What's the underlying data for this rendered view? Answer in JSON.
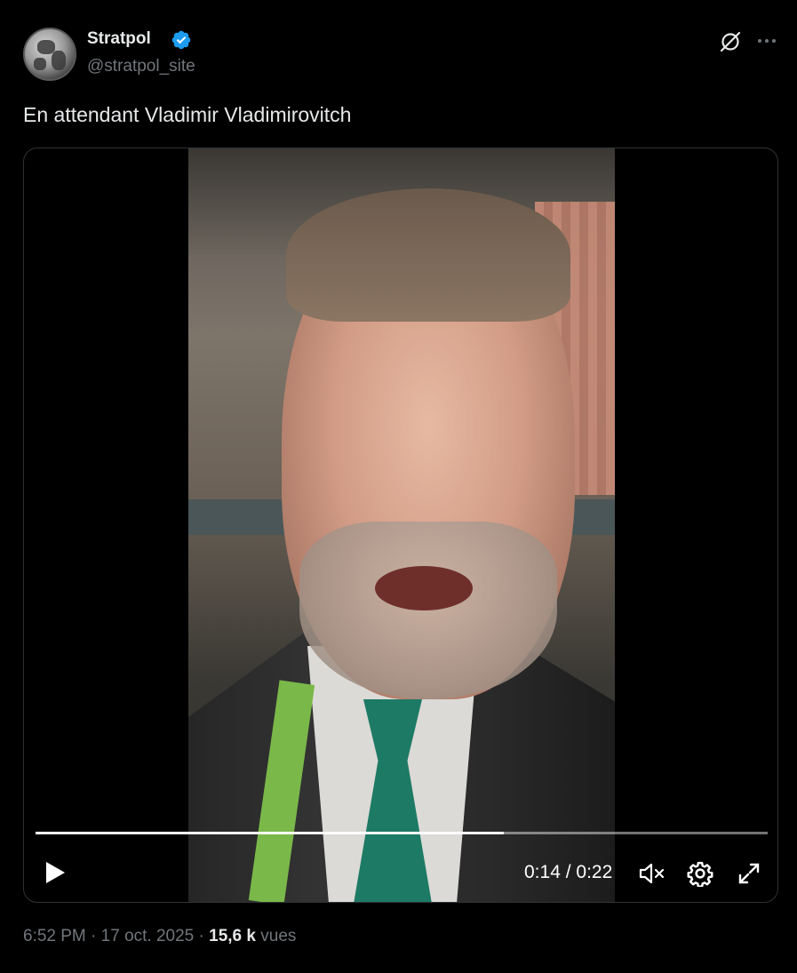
{
  "author": {
    "name": "Stratpol",
    "handle": "@stratpol_site",
    "verified": true,
    "verified_color": "#1d9bf0"
  },
  "post": {
    "text": "En attendant Vladimir Vladimirovitch"
  },
  "video": {
    "current_time": "0:14",
    "duration": "0:22",
    "time_separator": " / ",
    "progress_fraction": 0.64
  },
  "meta": {
    "time": "6:52 PM",
    "date": "17 oct. 2025",
    "separator": " · ",
    "views_count": "15,6 k",
    "views_label": "vues"
  },
  "icons": {
    "grok": "grok-icon",
    "more": "more-icon",
    "play": "play-icon",
    "mute": "muted-speaker-icon",
    "settings": "gear-icon",
    "fullscreen": "expand-icon"
  }
}
